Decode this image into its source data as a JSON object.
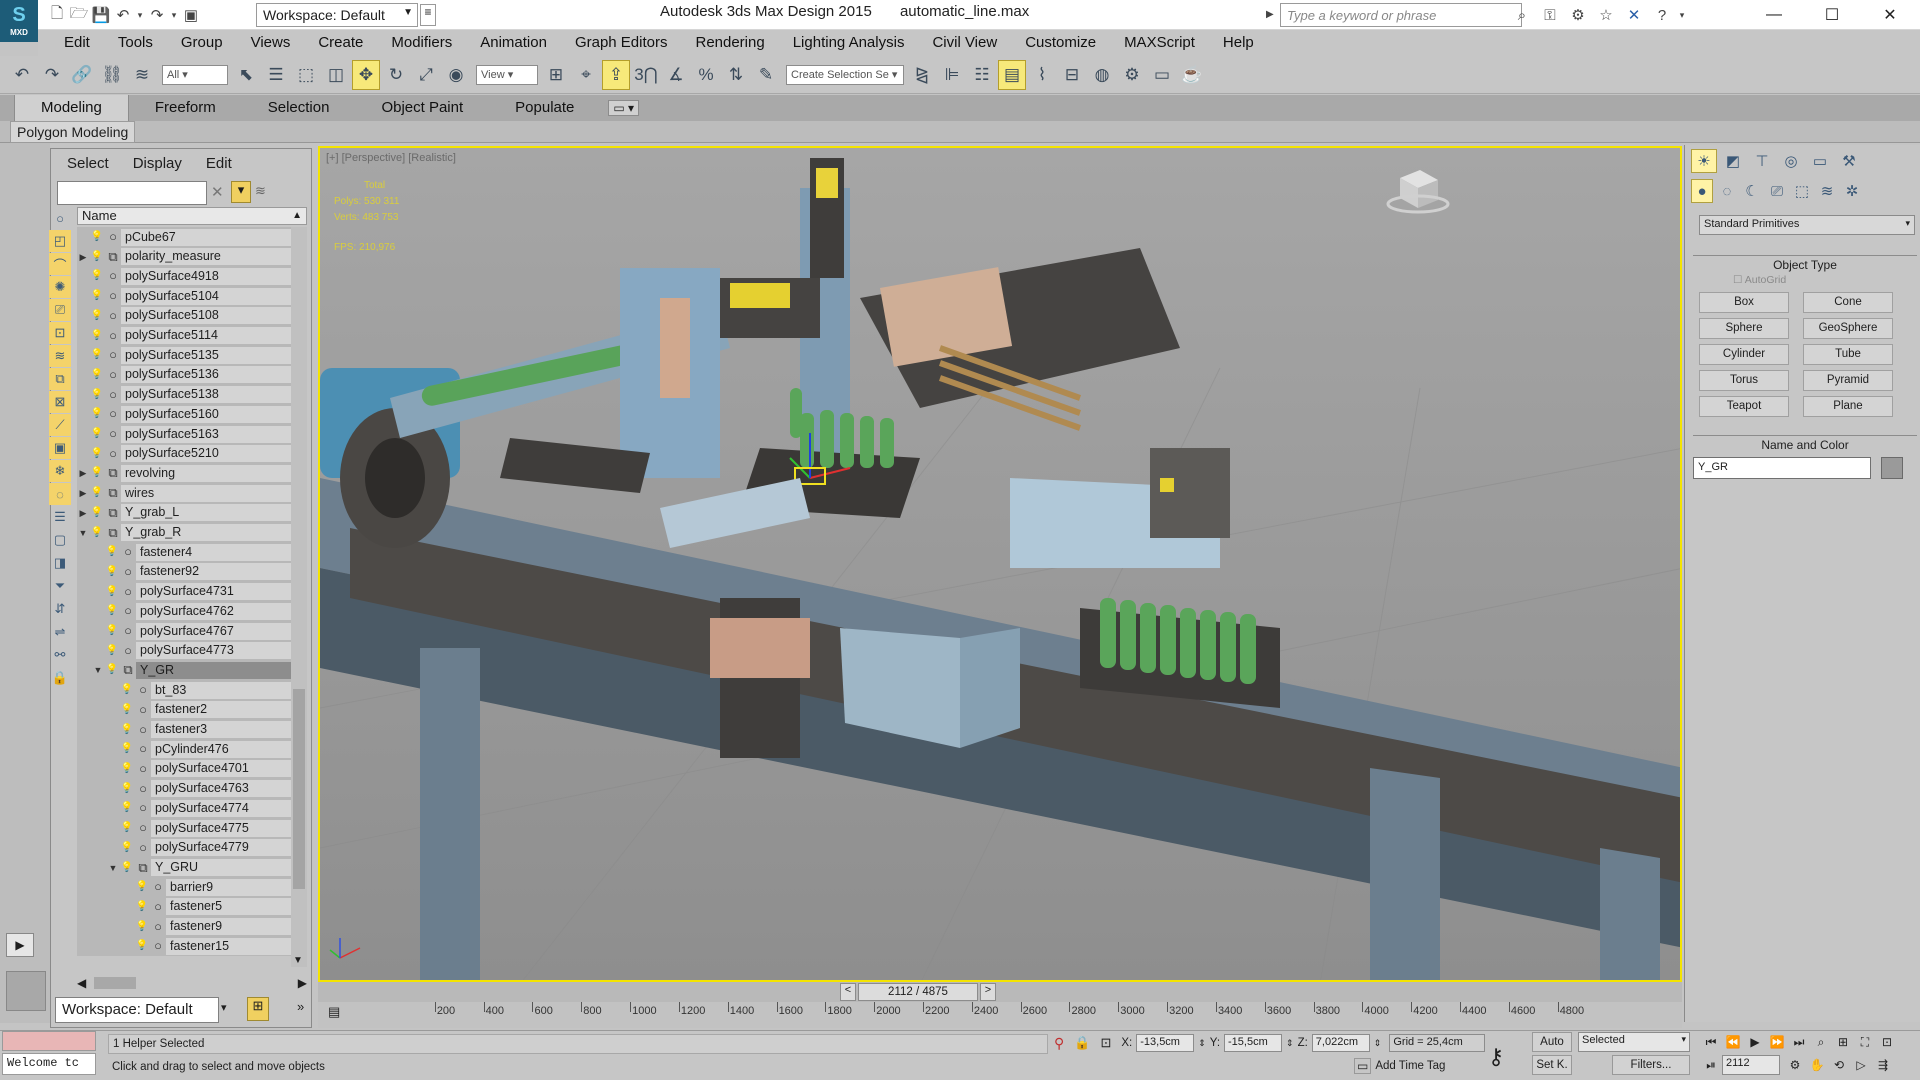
{
  "title_bar": {
    "app_name": "Autodesk 3ds Max Design 2015",
    "file_name": "automatic_line.max",
    "logo_text": "MXD",
    "workspace": "Workspace: Default",
    "search_placeholder": "Type a keyword or phrase"
  },
  "menu": [
    "Edit",
    "Tools",
    "Group",
    "Views",
    "Create",
    "Modifiers",
    "Animation",
    "Graph Editors",
    "Rendering",
    "Lighting Analysis",
    "Civil View",
    "Customize",
    "MAXScript",
    "Help"
  ],
  "main_toolbar": {
    "selection_filter": "All",
    "ref_coord": "View",
    "named_selection_placeholder": "Create Selection Se"
  },
  "ribbon": {
    "tabs": [
      "Modeling",
      "Freeform",
      "Selection",
      "Object Paint",
      "Populate"
    ],
    "active_tab": "Modeling",
    "sub_label": "Polygon Modeling"
  },
  "scene_explorer": {
    "menu": [
      "Select",
      "Display",
      "Edit"
    ],
    "header_name": "Name",
    "workspace": "Workspace: Default",
    "items": [
      {
        "name": "pCube67",
        "depth": 0,
        "exp": "",
        "icon": "○"
      },
      {
        "name": "polarity_measure",
        "depth": 0,
        "exp": "▶",
        "icon": "⧉"
      },
      {
        "name": "polySurface4918",
        "depth": 0,
        "exp": "",
        "icon": "○"
      },
      {
        "name": "polySurface5104",
        "depth": 0,
        "exp": "",
        "icon": "○"
      },
      {
        "name": "polySurface5108",
        "depth": 0,
        "exp": "",
        "icon": "○"
      },
      {
        "name": "polySurface5114",
        "depth": 0,
        "exp": "",
        "icon": "○"
      },
      {
        "name": "polySurface5135",
        "depth": 0,
        "exp": "",
        "icon": "○"
      },
      {
        "name": "polySurface5136",
        "depth": 0,
        "exp": "",
        "icon": "○"
      },
      {
        "name": "polySurface5138",
        "depth": 0,
        "exp": "",
        "icon": "○"
      },
      {
        "name": "polySurface5160",
        "depth": 0,
        "exp": "",
        "icon": "○"
      },
      {
        "name": "polySurface5163",
        "depth": 0,
        "exp": "",
        "icon": "○"
      },
      {
        "name": "polySurface5210",
        "depth": 0,
        "exp": "",
        "icon": "○"
      },
      {
        "name": "revolving",
        "depth": 0,
        "exp": "▶",
        "icon": "⧉"
      },
      {
        "name": "wires",
        "depth": 0,
        "exp": "▶",
        "icon": "⧉"
      },
      {
        "name": "Y_grab_L",
        "depth": 0,
        "exp": "▶",
        "icon": "⧉"
      },
      {
        "name": "Y_grab_R",
        "depth": 0,
        "exp": "▼",
        "icon": "⧉"
      },
      {
        "name": "fastener4",
        "depth": 1,
        "exp": "",
        "icon": "○"
      },
      {
        "name": "fastener92",
        "depth": 1,
        "exp": "",
        "icon": "○"
      },
      {
        "name": "polySurface4731",
        "depth": 1,
        "exp": "",
        "icon": "○"
      },
      {
        "name": "polySurface4762",
        "depth": 1,
        "exp": "",
        "icon": "○"
      },
      {
        "name": "polySurface4767",
        "depth": 1,
        "exp": "",
        "icon": "○"
      },
      {
        "name": "polySurface4773",
        "depth": 1,
        "exp": "",
        "icon": "○"
      },
      {
        "name": "Y_GR",
        "depth": 1,
        "exp": "▼",
        "icon": "⧉",
        "selected": true
      },
      {
        "name": "bt_83",
        "depth": 2,
        "exp": "",
        "icon": "○"
      },
      {
        "name": "fastener2",
        "depth": 2,
        "exp": "",
        "icon": "○"
      },
      {
        "name": "fastener3",
        "depth": 2,
        "exp": "",
        "icon": "○"
      },
      {
        "name": "pCylinder476",
        "depth": 2,
        "exp": "",
        "icon": "○"
      },
      {
        "name": "polySurface4701",
        "depth": 2,
        "exp": "",
        "icon": "○"
      },
      {
        "name": "polySurface4763",
        "depth": 2,
        "exp": "",
        "icon": "○"
      },
      {
        "name": "polySurface4774",
        "depth": 2,
        "exp": "",
        "icon": "○"
      },
      {
        "name": "polySurface4775",
        "depth": 2,
        "exp": "",
        "icon": "○"
      },
      {
        "name": "polySurface4779",
        "depth": 2,
        "exp": "",
        "icon": "○"
      },
      {
        "name": "Y_GRU",
        "depth": 2,
        "exp": "▼",
        "icon": "⧉"
      },
      {
        "name": "barrier9",
        "depth": 3,
        "exp": "",
        "icon": "○"
      },
      {
        "name": "fastener5",
        "depth": 3,
        "exp": "",
        "icon": "○"
      },
      {
        "name": "fastener9",
        "depth": 3,
        "exp": "",
        "icon": "○"
      },
      {
        "name": "fastener15",
        "depth": 3,
        "exp": "",
        "icon": "○"
      }
    ]
  },
  "viewport": {
    "label": "[+] [Perspective] [Realistic]",
    "stats_total": "Total",
    "polys": "Polys:  530 311",
    "verts": "Verts:  483 753",
    "fps": "FPS:    210,976"
  },
  "command_panel": {
    "dropdown": "Standard Primitives",
    "object_type_title": "Object Type",
    "autogrid": "AutoGrid",
    "buttons": [
      "Box",
      "Cone",
      "Sphere",
      "GeoSphere",
      "Cylinder",
      "Tube",
      "Torus",
      "Pyramid",
      "Teapot",
      "Plane"
    ],
    "name_color_title": "Name and Color",
    "name_value": "Y_GR"
  },
  "timeline": {
    "frame_display": "2112 / 4875",
    "prev": "<",
    "next": ">",
    "ticks": [
      "200",
      "400",
      "600",
      "800",
      "1000",
      "1200",
      "1400",
      "1600",
      "1800",
      "2000",
      "2200",
      "2400",
      "2600",
      "2800",
      "3000",
      "3200",
      "3400",
      "3600",
      "3800",
      "4000",
      "4200",
      "4400",
      "4600",
      "4800"
    ]
  },
  "status": {
    "listener_text": "Welcome tc",
    "selection": "1 Helper Selected",
    "prompt": "Click and drag to select and move objects",
    "x_label": "X:",
    "x_value": "-13,5cm",
    "y_label": "Y:",
    "y_value": "-15,5cm",
    "z_label": "Z:",
    "z_value": "7,022cm",
    "grid": "Grid = 25,4cm",
    "add_time_tag": "Add Time Tag",
    "auto_key": "Auto",
    "set_key": "Set K.",
    "key_mode": "Selected",
    "filters": "Filters...",
    "current_frame": "2112"
  }
}
